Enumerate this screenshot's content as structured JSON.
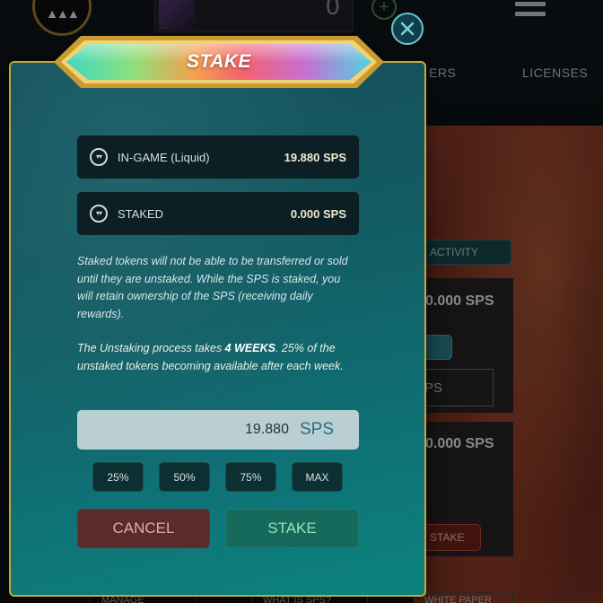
{
  "background": {
    "counter_value": "0",
    "tabs": [
      "ERS",
      "LICENSES"
    ],
    "activity_button": "ACTIVITY",
    "sps_amounts": [
      "0.000 SPS",
      "0.000 SPS"
    ],
    "outline_button": "PS",
    "stake_button": "STAKE",
    "footer_buttons": [
      "MANAGE WALLET",
      "WHAT IS SPS?",
      "WHITE PAPER"
    ]
  },
  "modal": {
    "title": "STAKE",
    "balances": {
      "in_game": {
        "label": "IN-GAME (Liquid)",
        "value": "19.880 SPS",
        "icon": "sps-coin-icon"
      },
      "staked": {
        "label": "STAKED",
        "value": "0.000 SPS",
        "icon": "sps-coin-icon"
      }
    },
    "info_text": "Staked tokens will not be able to be transferred or sold until they are unstaked. While the SPS is staked, you will retain ownership of the SPS (receiving daily rewards).",
    "unstaking": {
      "prefix": "The Unstaking process takes ",
      "duration": "4 WEEKS",
      "suffix": ". 25% of the unstaked tokens becoming available after each week."
    },
    "amount": {
      "value": "19.880",
      "unit": "SPS"
    },
    "percent_buttons": [
      "25%",
      "50%",
      "75%",
      "MAX"
    ],
    "cancel_label": "CANCEL",
    "stake_label": "STAKE"
  },
  "colors": {
    "modal_border": "#c9a43b",
    "modal_bg": "#135a62",
    "cancel_bg": "#5b2a2a",
    "stake_bg": "#156a5c"
  }
}
